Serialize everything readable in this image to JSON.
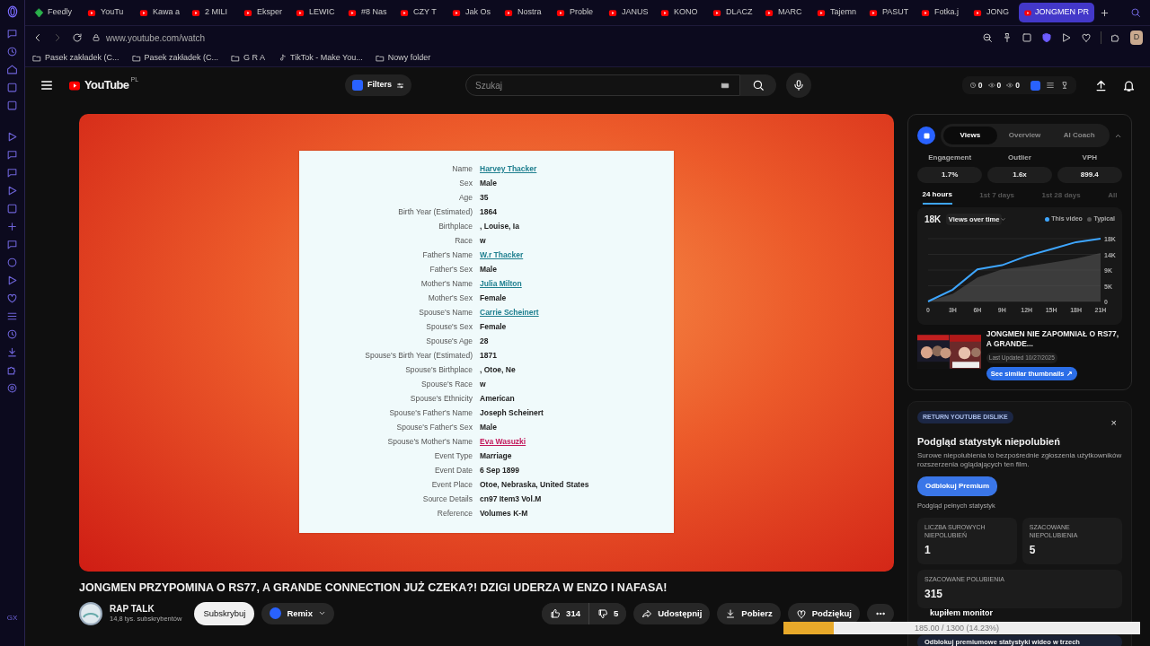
{
  "browser": {
    "tabs": [
      {
        "label": "Feedly",
        "kind": "feedly",
        "selected": false
      },
      {
        "label": "YouTu",
        "kind": "youtube",
        "selected": false
      },
      {
        "label": "Kawa a",
        "kind": "youtube",
        "selected": false
      },
      {
        "label": "2 MILI",
        "kind": "youtube",
        "selected": false
      },
      {
        "label": "Eksper",
        "kind": "youtube",
        "selected": false
      },
      {
        "label": "LEWIC",
        "kind": "youtube",
        "selected": false
      },
      {
        "label": "#8 Nas",
        "kind": "youtube",
        "selected": false
      },
      {
        "label": "CZY T",
        "kind": "youtube",
        "selected": false
      },
      {
        "label": "Jak Os",
        "kind": "youtube",
        "selected": false
      },
      {
        "label": "Nostra",
        "kind": "youtube",
        "selected": false
      },
      {
        "label": "Proble",
        "kind": "youtube",
        "selected": false
      },
      {
        "label": "JANUS",
        "kind": "youtube",
        "selected": false
      },
      {
        "label": "KONO",
        "kind": "youtube",
        "selected": false
      },
      {
        "label": "DLACZ",
        "kind": "youtube",
        "selected": false
      },
      {
        "label": "MARC",
        "kind": "youtube",
        "selected": false
      },
      {
        "label": "Tajemn",
        "kind": "youtube",
        "selected": false
      },
      {
        "label": "PASUT",
        "kind": "youtube",
        "selected": false
      },
      {
        "label": "Fotka.j",
        "kind": "youtube",
        "selected": false
      },
      {
        "label": "JONG",
        "kind": "youtube",
        "selected": false
      },
      {
        "label": "JONGMEN PR",
        "kind": "youtube",
        "selected": true
      }
    ],
    "address": "www.youtube.com/watch",
    "bookmarks": [
      {
        "label": "Pasek zakładek (C...",
        "kind": "folder"
      },
      {
        "label": "Pasek zakładek (C...",
        "kind": "folder"
      },
      {
        "label": "G R A",
        "kind": "folder"
      },
      {
        "label": "TikTok - Make You...",
        "kind": "tiktok"
      },
      {
        "label": "Nowy folder",
        "kind": "folder"
      }
    ],
    "profile": "D",
    "sidebar_label": "GX"
  },
  "youtube": {
    "logo": "YouTube",
    "region": "PL",
    "filters": "Filters",
    "search": {
      "placeholder": "Szukaj"
    },
    "counters": [
      "0",
      "0",
      "0"
    ]
  },
  "video": {
    "document": {
      "rows": [
        {
          "label": "Name",
          "value": "Harvey Thacker",
          "link": true,
          "color": "#1f7f8f"
        },
        {
          "label": "Sex",
          "value": "Male",
          "link": false
        },
        {
          "label": "Age",
          "value": "35",
          "link": false
        },
        {
          "label": "Birth Year (Estimated)",
          "value": "1864",
          "link": false
        },
        {
          "label": "Birthplace",
          "value": ", Louise, Ia",
          "link": false
        },
        {
          "label": "Race",
          "value": "w",
          "link": false
        },
        {
          "label": "Father's Name",
          "value": "W.r Thacker",
          "link": true,
          "color": "#1f7f8f"
        },
        {
          "label": "Father's Sex",
          "value": "Male",
          "link": false
        },
        {
          "label": "Mother's Name",
          "value": "Julia Milton",
          "link": true,
          "color": "#1f7f8f"
        },
        {
          "label": "Mother's Sex",
          "value": "Female",
          "link": false
        },
        {
          "label": "Spouse's Name",
          "value": "Carrie Scheinert",
          "link": true,
          "color": "#1f7f8f"
        },
        {
          "label": "Spouse's Sex",
          "value": "Female",
          "link": false
        },
        {
          "label": "Spouse's Age",
          "value": "28",
          "link": false
        },
        {
          "label": "Spouse's Birth Year (Estimated)",
          "value": "1871",
          "link": false
        },
        {
          "label": "Spouse's Birthplace",
          "value": ", Otoe, Ne",
          "link": false
        },
        {
          "label": "Spouse's Race",
          "value": "w",
          "link": false
        },
        {
          "label": "Spouse's Ethnicity",
          "value": "American",
          "link": false
        },
        {
          "label": "Spouse's Father's Name",
          "value": "Joseph Scheinert",
          "link": false
        },
        {
          "label": "Spouse's Father's Sex",
          "value": "Male",
          "link": false
        },
        {
          "label": "Spouse's Mother's Name",
          "value": "Eva Wasuzki",
          "link": true,
          "color": "#c2185b"
        },
        {
          "label": "Event Type",
          "value": "Marriage",
          "link": false
        },
        {
          "label": "Event Date",
          "value": "6 Sep 1899",
          "link": false
        },
        {
          "label": "Event Place",
          "value": "Otoe, Nebraska, United States",
          "link": false
        },
        {
          "label": "Source Details",
          "value": "cn97 Item3 Vol.M",
          "link": false
        },
        {
          "label": "Reference",
          "value": "Volumes K-M",
          "link": false
        }
      ]
    },
    "title": "JONGMEN PRZYPOMINA O RS77, A GRANDE CONNECTION JUŻ CZEKA?! DZIGI UDERZA W ENZO I NAFASA!",
    "channel": {
      "name": "RAP TALK",
      "subscribers": "14,8 tys. subskrybentów"
    },
    "subscribe": "Subskrybuj",
    "remix": "Remix",
    "likes": "314",
    "dislikes": "5",
    "actions": [
      {
        "label": "Udostępnij",
        "kind": "share"
      },
      {
        "label": "Pobierz",
        "kind": "download"
      },
      {
        "label": "Podziękuj",
        "kind": "thanks"
      }
    ]
  },
  "analytics": {
    "tabs": [
      {
        "label": "Views",
        "selected": true
      },
      {
        "label": "Overview",
        "selected": false
      },
      {
        "label": "AI Coach",
        "selected": false
      }
    ],
    "metrics": [
      {
        "label": "Engagement",
        "value": "1.7%"
      },
      {
        "label": "Outlier",
        "value": "1.6x"
      },
      {
        "label": "VPH",
        "value": "899.4"
      }
    ],
    "periods": [
      {
        "label": "24 hours",
        "selected": true
      },
      {
        "label": "1st 7 days",
        "selected": false
      },
      {
        "label": "1st 28 days",
        "selected": false
      },
      {
        "label": "All",
        "selected": false
      }
    ],
    "total": "18K",
    "metric_select": "Views over time",
    "chart_data": {
      "type": "line",
      "x": [
        0,
        3,
        6,
        9,
        12,
        15,
        18,
        21
      ],
      "series": [
        {
          "name": "This video",
          "type": "line",
          "color": "#3ea6ff",
          "values": [
            0,
            3400,
            9200,
            10400,
            13000,
            15000,
            17000,
            18000
          ]
        },
        {
          "name": "Typical",
          "type": "area",
          "color": "#555555",
          "values": [
            0,
            2200,
            6900,
            9200,
            10000,
            11100,
            12300,
            13900
          ]
        }
      ],
      "xlim": [
        0,
        21
      ],
      "xticks": [
        {
          "value": 0,
          "label": "0"
        },
        {
          "value": 3,
          "label": "3H"
        },
        {
          "value": 6,
          "label": "6H"
        },
        {
          "value": 9,
          "label": "9H"
        },
        {
          "value": 12,
          "label": "12H"
        },
        {
          "value": 15,
          "label": "15H"
        },
        {
          "value": 18,
          "label": "18H"
        },
        {
          "value": 21,
          "label": "21H"
        }
      ],
      "yticks": [
        {
          "value": 0,
          "label": "0"
        },
        {
          "value": 4500,
          "label": "5K"
        },
        {
          "value": 9000,
          "label": "9K"
        },
        {
          "value": 13500,
          "label": "14K"
        },
        {
          "value": 18000,
          "label": "18K"
        }
      ],
      "ylim": [
        0,
        18000
      ],
      "grid": true
    },
    "related": {
      "title": "JONGMEN NIE ZAPOMNIAŁ O RS77, A GRANDE...",
      "updated": "Last Updated 10/27/2025",
      "button": "See similar thumbnails ↗"
    }
  },
  "dislike_panel": {
    "badge": "RETURN YOUTUBE DISLIKE",
    "close": "×",
    "title": "Podgląd statystyk niepolubień",
    "description": "Surowe niepolubienia to bezpośrednie zgłoszenia użytkowników rozszerzenia oglądających ten film.",
    "button": "Odblokuj Premium",
    "note": "Podgląd pełnych statystyk",
    "stats": [
      {
        "label": "LICZBA SUROWYCH NIEPOLUBIEŃ",
        "value": "1"
      },
      {
        "label": "SZACOWANE NIEPOLUBIENIA",
        "value": "5"
      },
      {
        "label": "SZACOWANE POLUBIENIA",
        "value": "315"
      }
    ],
    "promo": "Odblokuj premiumowe statystyki wideo w trzech"
  },
  "overlay": {
    "label": "kupiłem monitor",
    "level": 0.1423,
    "reading": "185.00 / 1300 (14.23%)"
  }
}
